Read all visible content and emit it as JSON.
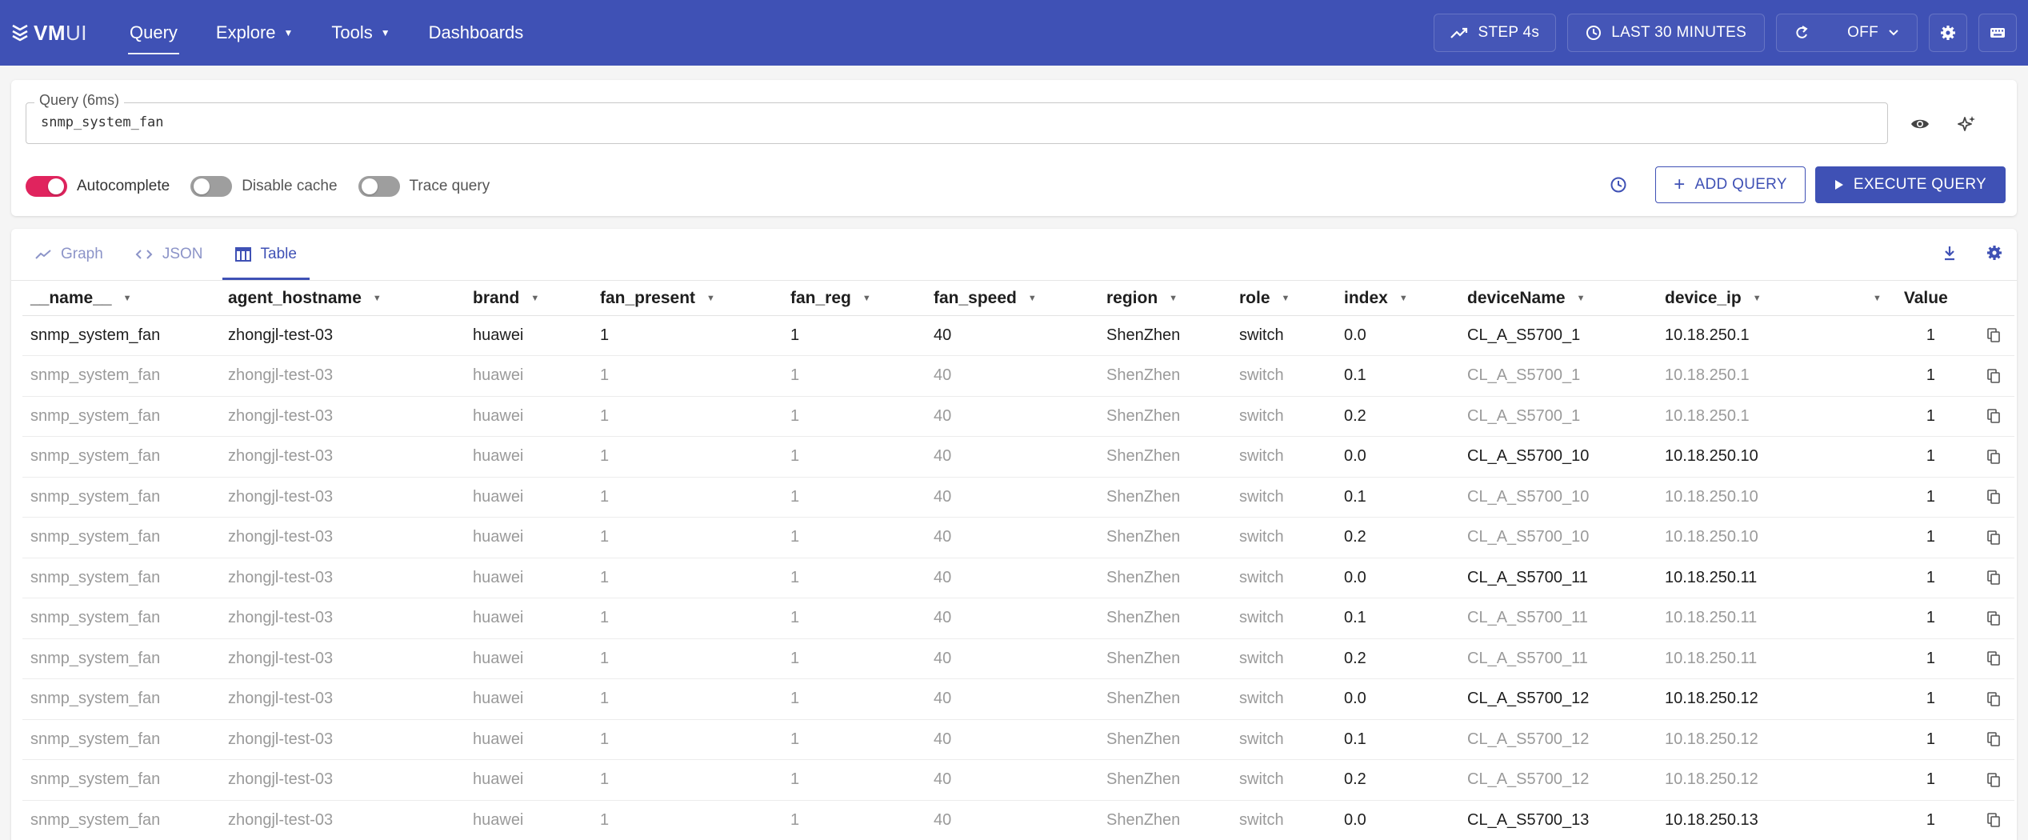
{
  "header": {
    "logo": {
      "bold": "VM",
      "light": "UI"
    },
    "nav": [
      {
        "label": "Query",
        "has_caret": false,
        "active": true
      },
      {
        "label": "Explore",
        "has_caret": true,
        "active": false
      },
      {
        "label": "Tools",
        "has_caret": true,
        "active": false
      },
      {
        "label": "Dashboards",
        "has_caret": false,
        "active": false
      }
    ],
    "step_label": "STEP 4s",
    "time_range_label": "LAST 30 MINUTES",
    "refresh_label": "OFF"
  },
  "query": {
    "label": "Query (6ms)",
    "value": "snmp_system_fan",
    "toggles": [
      {
        "label": "Autocomplete",
        "on": true
      },
      {
        "label": "Disable cache",
        "on": false
      },
      {
        "label": "Trace query",
        "on": false
      }
    ],
    "add_query_label": "ADD QUERY",
    "execute_query_label": "EXECUTE QUERY"
  },
  "tabs": [
    {
      "label": "Graph",
      "icon": "graph-icon",
      "active": false
    },
    {
      "label": "JSON",
      "icon": "code-icon",
      "active": false
    },
    {
      "label": "Table",
      "icon": "table-icon",
      "active": true
    }
  ],
  "table": {
    "columns": [
      "__name__",
      "agent_hostname",
      "brand",
      "fan_present",
      "fan_reg",
      "fan_speed",
      "region",
      "role",
      "index",
      "deviceName",
      "device_ip",
      "Value"
    ],
    "rows": [
      {
        "cells": [
          "snmp_system_fan",
          "zhongjl-test-03",
          "huawei",
          "1",
          "1",
          "40",
          "ShenZhen",
          "switch",
          "0.0",
          "CL_A_S5700_1",
          "10.18.250.1",
          "1"
        ],
        "new_group": true
      },
      {
        "cells": [
          "snmp_system_fan",
          "zhongjl-test-03",
          "huawei",
          "1",
          "1",
          "40",
          "ShenZhen",
          "switch",
          "0.1",
          "CL_A_S5700_1",
          "10.18.250.1",
          "1"
        ],
        "new_group": false
      },
      {
        "cells": [
          "snmp_system_fan",
          "zhongjl-test-03",
          "huawei",
          "1",
          "1",
          "40",
          "ShenZhen",
          "switch",
          "0.2",
          "CL_A_S5700_1",
          "10.18.250.1",
          "1"
        ],
        "new_group": false
      },
      {
        "cells": [
          "snmp_system_fan",
          "zhongjl-test-03",
          "huawei",
          "1",
          "1",
          "40",
          "ShenZhen",
          "switch",
          "0.0",
          "CL_A_S5700_10",
          "10.18.250.10",
          "1"
        ],
        "new_device": true
      },
      {
        "cells": [
          "snmp_system_fan",
          "zhongjl-test-03",
          "huawei",
          "1",
          "1",
          "40",
          "ShenZhen",
          "switch",
          "0.1",
          "CL_A_S5700_10",
          "10.18.250.10",
          "1"
        ],
        "new_device": false
      },
      {
        "cells": [
          "snmp_system_fan",
          "zhongjl-test-03",
          "huawei",
          "1",
          "1",
          "40",
          "ShenZhen",
          "switch",
          "0.2",
          "CL_A_S5700_10",
          "10.18.250.10",
          "1"
        ],
        "new_device": false
      },
      {
        "cells": [
          "snmp_system_fan",
          "zhongjl-test-03",
          "huawei",
          "1",
          "1",
          "40",
          "ShenZhen",
          "switch",
          "0.0",
          "CL_A_S5700_11",
          "10.18.250.11",
          "1"
        ],
        "new_device": true
      },
      {
        "cells": [
          "snmp_system_fan",
          "zhongjl-test-03",
          "huawei",
          "1",
          "1",
          "40",
          "ShenZhen",
          "switch",
          "0.1",
          "CL_A_S5700_11",
          "10.18.250.11",
          "1"
        ],
        "new_device": false
      },
      {
        "cells": [
          "snmp_system_fan",
          "zhongjl-test-03",
          "huawei",
          "1",
          "1",
          "40",
          "ShenZhen",
          "switch",
          "0.2",
          "CL_A_S5700_11",
          "10.18.250.11",
          "1"
        ],
        "new_device": false
      },
      {
        "cells": [
          "snmp_system_fan",
          "zhongjl-test-03",
          "huawei",
          "1",
          "1",
          "40",
          "ShenZhen",
          "switch",
          "0.0",
          "CL_A_S5700_12",
          "10.18.250.12",
          "1"
        ],
        "new_device": true
      },
      {
        "cells": [
          "snmp_system_fan",
          "zhongjl-test-03",
          "huawei",
          "1",
          "1",
          "40",
          "ShenZhen",
          "switch",
          "0.1",
          "CL_A_S5700_12",
          "10.18.250.12",
          "1"
        ],
        "new_device": false
      },
      {
        "cells": [
          "snmp_system_fan",
          "zhongjl-test-03",
          "huawei",
          "1",
          "1",
          "40",
          "ShenZhen",
          "switch",
          "0.2",
          "CL_A_S5700_12",
          "10.18.250.12",
          "1"
        ],
        "new_device": false
      },
      {
        "cells": [
          "snmp_system_fan",
          "zhongjl-test-03",
          "huawei",
          "1",
          "1",
          "40",
          "ShenZhen",
          "switch",
          "0.0",
          "CL_A_S5700_13",
          "10.18.250.13",
          "1"
        ],
        "new_device": true
      }
    ]
  }
}
